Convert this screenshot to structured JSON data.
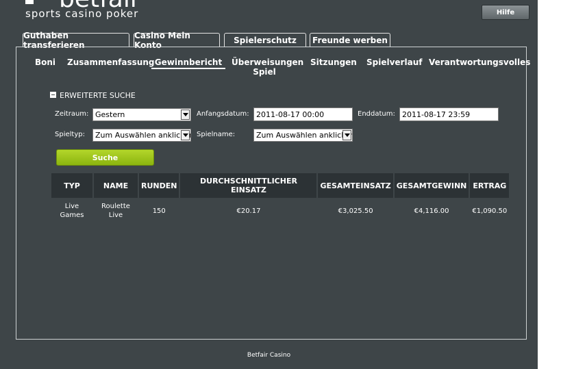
{
  "brand": {
    "name": "betfair",
    "tagline": "sports casino poker"
  },
  "header": {
    "help_label": "Hilfe"
  },
  "tabs": [
    {
      "label": "Guthaben transferieren"
    },
    {
      "label": "Casino Mein Konto"
    },
    {
      "label": "Spielerschutz"
    },
    {
      "label": "Freunde werben"
    }
  ],
  "subnav": [
    {
      "label": "Boni"
    },
    {
      "label": "Zusammenfassung"
    },
    {
      "label": "Gewinnbericht",
      "active": true
    },
    {
      "label": "Überweisungen Spiel"
    },
    {
      "label": "Sitzungen"
    },
    {
      "label": "Spielverlauf"
    },
    {
      "label": "Verantwortungsvolles"
    }
  ],
  "search": {
    "section_label": "ERWEITERTE SUCHE",
    "period_label": "Zeitraum:",
    "period_value": "Gestern",
    "start_label": "Anfangsdatum:",
    "start_value": "2011-08-17 00:00",
    "end_label": "Enddatum:",
    "end_value": "2011-08-17 23:59",
    "gametype_label": "Spieltyp:",
    "gametype_value": "Zum Auswählen anklicken",
    "gamename_label": "Spielname:",
    "gamename_value": "Zum Auswählen anklicken",
    "button_label": "Suche"
  },
  "results": {
    "headers": [
      "TYP",
      "NAME",
      "RUNDEN",
      "DURCHSCHNITTLICHER EINSATZ",
      "GESAMTEINSATZ",
      "GESAMTGEWINN",
      "ERTRAG"
    ],
    "rows": [
      [
        "Live Games",
        "Roulette Live",
        "150",
        "€20.17",
        "€3,025.50",
        "€4,116.00",
        "€1,090.50"
      ]
    ]
  },
  "footer": {
    "text": "Betfair Casino"
  },
  "colors": {
    "background": "#3e4548",
    "accent_button": "#9ec41d",
    "header_cell": "#2c3235"
  }
}
